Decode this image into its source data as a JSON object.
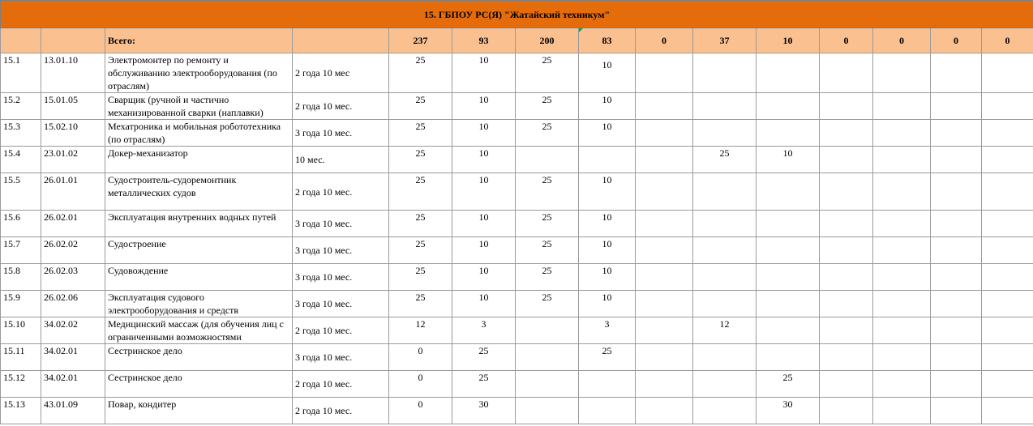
{
  "title": "15. ГБПОУ РС(Я) \"Жатайский техникум\"",
  "totals": {
    "label": "Всего:",
    "values": [
      "237",
      "93",
      "200",
      "83",
      "0",
      "37",
      "10",
      "0",
      "0",
      "0",
      "0"
    ]
  },
  "rows": [
    {
      "num": "15.1",
      "code": "13.01.10",
      "name": "Электромонтер по ремонту и обслуживанию электрооборудования (по отраслям)",
      "duration": "2 года 10 мес",
      "values": [
        "25",
        "10",
        "25",
        "10",
        "",
        "",
        "",
        "",
        "",
        "",
        ""
      ]
    },
    {
      "num": "15.2",
      "code": "15.01.05",
      "name": "Сварщик (ручной и частично механизированной сварки (наплавки)",
      "duration": "2 года 10 мес.",
      "values": [
        "25",
        "10",
        "25",
        "10",
        "",
        "",
        "",
        "",
        "",
        "",
        ""
      ]
    },
    {
      "num": "15.3",
      "code": "15.02.10",
      "name": "Мехатроника и мобильная робототехника (по отраслям)",
      "duration": "3 года 10 мес.",
      "values": [
        "25",
        "10",
        "25",
        "10",
        "",
        "",
        "",
        "",
        "",
        "",
        ""
      ]
    },
    {
      "num": "15.4",
      "code": "23.01.02",
      "name": "Докер-механизатор",
      "duration": "10 мес.",
      "values": [
        "25",
        "10",
        "",
        "",
        "",
        "25",
        "10",
        "",
        "",
        "",
        ""
      ]
    },
    {
      "num": "15.5",
      "code": "26.01.01",
      "name": "Судостроитель-судоремонтник металлических судов",
      "duration": "2 года 10 мес.",
      "values": [
        "25",
        "10",
        "25",
        "10",
        "",
        "",
        "",
        "",
        "",
        "",
        ""
      ]
    },
    {
      "num": "15.6",
      "code": "26.02.01",
      "name": "Эксплуатация внутренних водных путей",
      "duration": "3 года 10 мес.",
      "values": [
        "25",
        "10",
        "25",
        "10",
        "",
        "",
        "",
        "",
        "",
        "",
        ""
      ]
    },
    {
      "num": "15.7",
      "code": "26.02.02",
      "name": "Судостроение",
      "duration": "3 года 10 мес.",
      "values": [
        "25",
        "10",
        "25",
        "10",
        "",
        "",
        "",
        "",
        "",
        "",
        ""
      ]
    },
    {
      "num": "15.8",
      "code": "26.02.03",
      "name": "Судовождение",
      "duration": "3 года 10 мес.",
      "values": [
        "25",
        "10",
        "25",
        "10",
        "",
        "",
        "",
        "",
        "",
        "",
        ""
      ]
    },
    {
      "num": "15.9",
      "code": "26.02.06",
      "name": "Эксплуатация судового электрооборудования и средств",
      "duration": "3 года 10 мес.",
      "values": [
        "25",
        "10",
        "25",
        "10",
        "",
        "",
        "",
        "",
        "",
        "",
        ""
      ]
    },
    {
      "num": "15.10",
      "code": "34.02.02",
      "name": "Медицинский массаж (для обучения лиц с ограниченными возможностями",
      "duration": "2 года 10 мес.",
      "values": [
        "12",
        "3",
        "",
        "3",
        "",
        "12",
        "",
        "",
        "",
        "",
        ""
      ]
    },
    {
      "num": "15.11",
      "code": "34.02.01",
      "name": "Сестринское дело",
      "duration": "3 года 10 мес.",
      "values": [
        "0",
        "25",
        "",
        "25",
        "",
        "",
        "",
        "",
        "",
        "",
        ""
      ]
    },
    {
      "num": "15.12",
      "code": "34.02.01",
      "name": "Сестринское дело",
      "duration": "2 года 10 мес.",
      "values": [
        "0",
        "25",
        "",
        "",
        "",
        "",
        "25",
        "",
        "",
        "",
        ""
      ]
    },
    {
      "num": "15.13",
      "code": "43.01.09",
      "name": "Повар, кондитер",
      "duration": "2 года 10 мес.",
      "values": [
        "0",
        "30",
        "",
        "",
        "",
        "",
        "30",
        "",
        "",
        "",
        ""
      ]
    }
  ]
}
